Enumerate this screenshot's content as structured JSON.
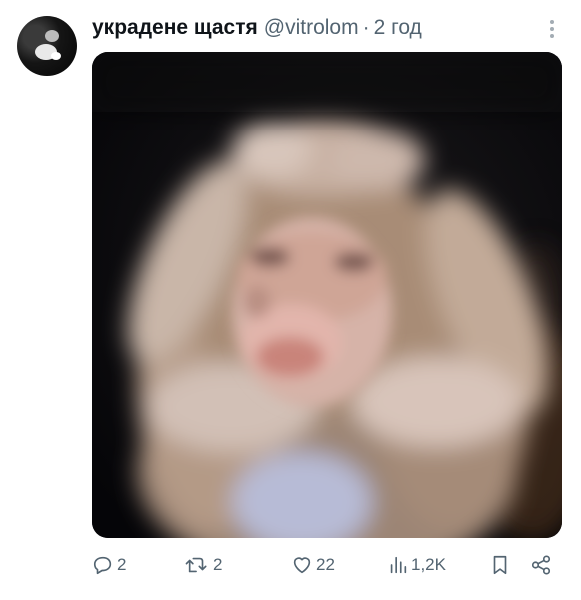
{
  "tweet": {
    "display_name": "украдене щастя",
    "handle": "@vitrolom",
    "separator": "·",
    "time": "2 год",
    "media_subject": "blurred monkey holding its head"
  },
  "actions": {
    "replies": "2",
    "reposts": "2",
    "likes": "22",
    "views": "1,2K"
  },
  "icons": {
    "avatar": "avatar",
    "more": "more-icon",
    "reply": "reply-icon",
    "repost": "repost-icon",
    "like": "like-icon",
    "views": "views-icon",
    "bookmark": "bookmark-icon",
    "share": "share-icon"
  },
  "colors": {
    "text": "#0f1419",
    "secondary": "#536471",
    "background": "#ffffff"
  }
}
